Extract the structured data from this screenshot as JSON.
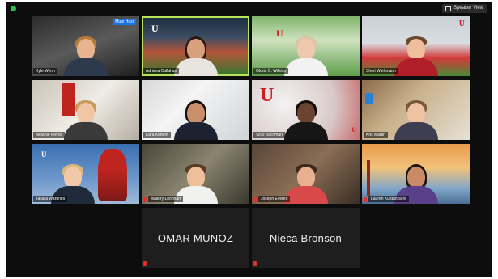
{
  "topbar": {
    "view_label": "Speaker View"
  },
  "participants": [
    {
      "name": "Kyle Wynn",
      "badge": "Mute Host"
    },
    {
      "name": "Adriana Callahan"
    },
    {
      "name": "Gloria C. Wilkins"
    },
    {
      "name": "Sheri Wiehmann"
    },
    {
      "name": "Melanie Pierce"
    },
    {
      "name": "Kara Kimeth"
    },
    {
      "name": "Vicki Bachman"
    },
    {
      "name": "Kris Martin"
    },
    {
      "name": "Takara Warrines"
    },
    {
      "name": "Mallory Leonhart"
    },
    {
      "name": "Joseph Everett"
    },
    {
      "name": "Lauren Kustanzarre"
    },
    {
      "name": "OMAR MUNOZ"
    },
    {
      "name": "Nieca Bronson"
    }
  ],
  "colors": {
    "active_speaker": "#b9e35a",
    "muted": "#e0312b",
    "utah_red": "#cc1f1f"
  }
}
